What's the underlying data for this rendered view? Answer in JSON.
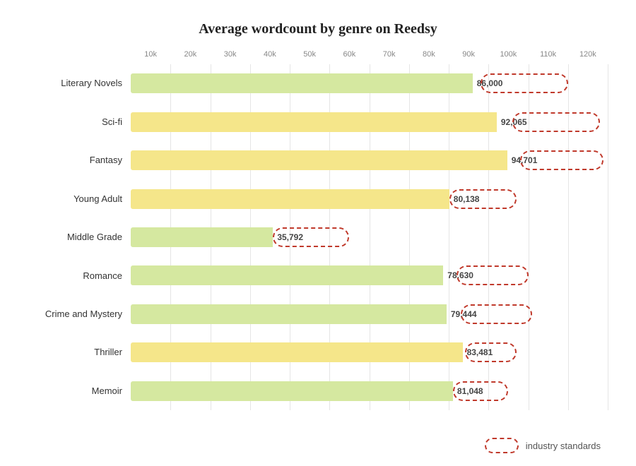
{
  "title": "Average wordcount by genre on Reedsy",
  "xAxis": {
    "labels": [
      "10k",
      "20k",
      "30k",
      "40k",
      "50k",
      "60k",
      "70k",
      "80k",
      "90k",
      "100k",
      "110k",
      "120k"
    ],
    "min": 0,
    "max": 120000,
    "step": 10000
  },
  "bars": [
    {
      "genre": "Literary Novels",
      "value": 86000,
      "label": "86,000",
      "color": "green",
      "industryMin": 88000,
      "industryMax": 110000
    },
    {
      "genre": "Sci-fi",
      "value": 92065,
      "label": "92,065",
      "color": "yellow",
      "industryMin": 96000,
      "industryMax": 118000
    },
    {
      "genre": "Fantasy",
      "value": 94701,
      "label": "94,701",
      "color": "yellow",
      "industryMin": 98000,
      "industryMax": 119000
    },
    {
      "genre": "Young Adult",
      "value": 80138,
      "label": "80,138",
      "color": "yellow",
      "industryMin": 80138,
      "industryMax": 97000
    },
    {
      "genre": "Middle Grade",
      "value": 35792,
      "label": "35,792",
      "color": "green",
      "industryMin": 35792,
      "industryMax": 55000
    },
    {
      "genre": "Romance",
      "value": 78630,
      "label": "78,630",
      "color": "green",
      "industryMin": 82000,
      "industryMax": 100000
    },
    {
      "genre": "Crime and Mystery",
      "value": 79444,
      "label": "79,444",
      "color": "green",
      "industryMin": 83000,
      "industryMax": 101000
    },
    {
      "genre": "Thriller",
      "value": 83481,
      "label": "83,481",
      "color": "yellow",
      "industryMin": 84000,
      "industryMax": 97000
    },
    {
      "genre": "Memoir",
      "value": 81048,
      "label": "81,048",
      "color": "green",
      "industryMin": 81048,
      "industryMax": 95000
    }
  ],
  "legend": {
    "label": "industry standards"
  }
}
